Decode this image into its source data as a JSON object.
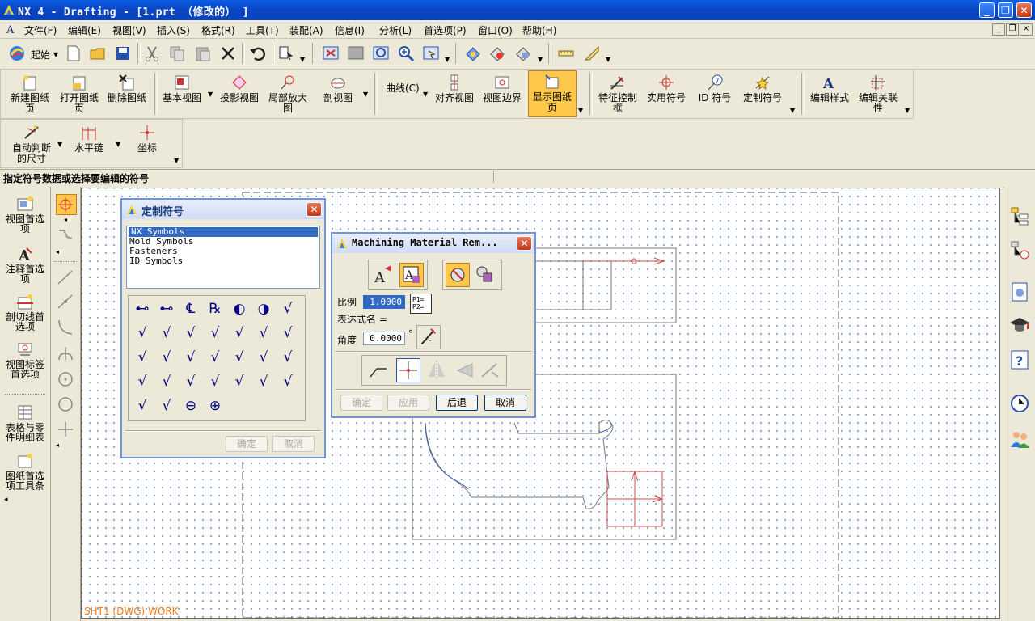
{
  "window": {
    "title": "NX 4 - Drafting - [1.prt （修改的） ]"
  },
  "menu": [
    "文件(F)",
    "编辑(E)",
    "视图(V)",
    "插入(S)",
    "格式(R)",
    "工具(T)",
    "装配(A)",
    "信息(I)",
    "分析(L)",
    "首选项(P)",
    "窗口(O)",
    "帮助(H)"
  ],
  "toolbar": {
    "start_label": "起始"
  },
  "drafting_toolbar": {
    "new_sheet": "新建图纸页",
    "open_sheet": "打开图纸页",
    "delete_sheet": "删除图纸",
    "base_view": "基本视图",
    "projected_view": "投影视图",
    "detail_view": "局部放大图",
    "section_view": "剖视图",
    "curve": "曲线(C)",
    "align_view": "对齐视图",
    "view_boundary": "视图边界",
    "display_sheet": "显示图纸页",
    "fcf": "特征控制框",
    "utility_symbol": "实用符号",
    "id_symbol": "ID 符号",
    "custom_symbol": "定制符号",
    "edit_style": "编辑样式",
    "edit_assoc": "编辑关联性"
  },
  "dim_toolbar": {
    "auto_dim": "自动判断的尺寸",
    "horiz_chain": "水平链",
    "coordinate": "坐标"
  },
  "status": {
    "prompt": "指定符号数据或选择要编辑的符号"
  },
  "left_panel": [
    "视图首选项",
    "注释首选项",
    "剖切线首选项",
    "视图标签首选项",
    "表格与零件明细表",
    "图纸首选项工具条"
  ],
  "custom_symbol_dialog": {
    "title": "定制符号",
    "libraries": [
      "NX Symbols",
      "Mold Symbols",
      "Fasteners",
      "ID Symbols"
    ],
    "selected_library": "NX Symbols",
    "symbols": [
      "⊷",
      "⊷",
      "℄",
      "℞",
      "◐",
      "◑",
      "√",
      "√",
      "√",
      "√",
      "√",
      "√",
      "√",
      "√",
      "√",
      "√",
      "√",
      "√",
      "√",
      "√",
      "√",
      "√",
      "√",
      "√",
      "√",
      "√",
      "√",
      "√",
      "√",
      "√",
      "⊖",
      "⊕"
    ],
    "ok_label": "确定",
    "cancel_label": "取消"
  },
  "mmr_dialog": {
    "title": "Machining Material Rem...",
    "scale_label": "比例",
    "scale_value": "1.0000",
    "expr_label": "表达式名 =",
    "angle_label": "角度",
    "angle_value": "0.0000",
    "degree": "°",
    "scale_btn": "P1=\nP2=",
    "ok_label": "确定",
    "apply_label": "应用",
    "back_label": "后退",
    "cancel_label": "取消"
  },
  "sheet_label": "SHT1 (DWG) WORK",
  "colors": {
    "accent": "#0a5ee6",
    "selected": "#ffc84a",
    "sheet_label": "#ff7a1a",
    "geometry_red": "#c85050"
  }
}
